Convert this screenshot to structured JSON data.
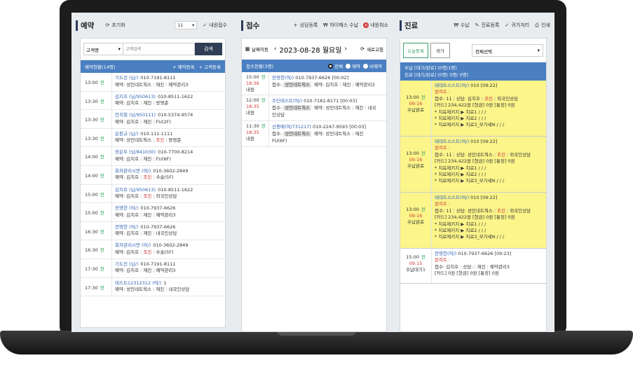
{
  "reservation": {
    "title": "예약",
    "reset": "초기화",
    "count_select": "11",
    "visit_checkbox": "내원접수",
    "search_type": "고객명",
    "search_placeholder": "고객검색",
    "search_button": "검색",
    "list_title": "예약현황(14명)",
    "add_reservation": "예약등록",
    "add_customer": "고객등록",
    "items": [
      {
        "time": "13:00",
        "status": "전",
        "name": "기도진 (님/)",
        "phone": "010-7191-8111",
        "line2_label": "예약:",
        "line2": [
          "성민네트웍스",
          "재진",
          "예약관리3"
        ],
        "red_index": -1
      },
      {
        "time": "13:30",
        "status": "전",
        "name": "김지호 (님/950613)",
        "phone": "010-8511-1622",
        "line2_label": "예약:",
        "line2": [
          "김치호",
          "재진",
          "왕영준"
        ],
        "red_index": -1
      },
      {
        "time": "13:30",
        "status": "전",
        "name": "안치철 (님/950111)",
        "phone": "010-5374-9574",
        "line2_label": "예약:",
        "line2": [
          "김치호",
          "재진",
          "FU(2F)"
        ],
        "red_index": -1
      },
      {
        "time": "13:30",
        "status": "전",
        "name": "은판규 (님/)",
        "phone": "010-111-1111",
        "line2_label": "예약:",
        "line2": [
          "성민네트웍스",
          "조진",
          "왕영준"
        ],
        "red_index": 1
      },
      {
        "time": "14:00",
        "status": "전",
        "name": "장은두 (님/841030)",
        "phone": "010-7700-8214",
        "line2_label": "예약:",
        "line2": [
          "김치호",
          "재진",
          "FU(6F)"
        ],
        "red_index": -1
      },
      {
        "time": "14:00",
        "status": "전",
        "name": "회차관리시면 (여/)",
        "phone": "010-3602-2849",
        "line2_label": "예약:",
        "line2": [
          "김치호",
          "조진",
          "수술(5F)"
        ],
        "red_index": 1
      },
      {
        "time": "15:00",
        "status": "전",
        "name": "김지호 (님/950613)",
        "phone": "010-8511-1622",
        "line2_label": "예약:",
        "line2": [
          "김치호",
          "조진",
          "외국인상담"
        ],
        "red_index": 1
      },
      {
        "time": "15:00",
        "status": "전",
        "name": "전영한 (여/)",
        "phone": "010-7937-6626",
        "line2_label": "예약:",
        "line2": [
          "김치호",
          "재진",
          "예약관리3"
        ],
        "red_index": -1
      },
      {
        "time": "16:30",
        "status": "전",
        "name": "전영한 (여/)",
        "phone": "010-7937-6626",
        "line2_label": "예약:",
        "line2": [
          "김치호",
          "재진",
          "내국인상담"
        ],
        "red_index": -1
      },
      {
        "time": "16:30",
        "status": "전",
        "name": "회차관리시면 (여/)",
        "phone": "010-3602-2849",
        "line2_label": "예약:",
        "line2": [
          "김치호",
          "조진",
          "수술(5F)"
        ],
        "red_index": 1
      },
      {
        "time": "17:30",
        "status": "전",
        "name": "기도진 (님/)",
        "phone": "010-7191-8111",
        "line2_label": "예약:",
        "line2": [
          "김치호",
          "재진",
          "예약관리3"
        ],
        "red_index": -1
      },
      {
        "time": "17:30",
        "status": "전",
        "name": "테스트12312312 (여/)",
        "phone": "1",
        "line2_label": "예약:",
        "line2": [
          "성민네트웍스",
          "재진",
          "내국인상담"
        ],
        "red_index": -1
      }
    ]
  },
  "reception": {
    "title": "접수",
    "btn_consult": "상담등록",
    "btn_payment": "하이패스 수납",
    "btn_cancel": "내원취소",
    "date_move": "날짜이동",
    "date": "2023-08-28 월요일",
    "refresh": "새로고침",
    "list_title": "접수현황(3명)",
    "filter_all": "전체",
    "filter_reservation": "예약",
    "filter_nonreservation": "비예약",
    "items": [
      {
        "time": "15:00",
        "status": "전",
        "time2": "18:36",
        "state": "내원",
        "name": "전영한(여/)",
        "phone": "010-7937-6626",
        "code": "[00:02]",
        "line2_label": "접수:",
        "tag": "성민네트웍스",
        "line2": [
          "예약: 김치호",
          "재진",
          "예약관리3"
        ],
        "line3": ""
      },
      {
        "time": "12:00",
        "status": "전",
        "time2": "18:35",
        "state": "내원",
        "name": "주딘테스트(여/)",
        "phone": "010-7181-8171",
        "code": "[00:03]",
        "line2_label": "접수:",
        "tag": "성민네트웍스",
        "line2": [
          "예약: 성민네트웍스",
          "재진",
          "내국"
        ],
        "line3": "인상담"
      },
      {
        "time": "11:30",
        "status": "전",
        "time2": "18:35",
        "state": "내원",
        "name": "산중배(여/731217)",
        "phone": "010-2247-9593",
        "code": "[00:03]",
        "line2_label": "접수:",
        "tag": "성민네트웍스",
        "line2": [
          "예약: 성민네트웍스",
          "재진"
        ],
        "line3": "FU(6F)"
      }
    ]
  },
  "treatment": {
    "title": "진료",
    "btn_payment": "수납",
    "btn_register": "진료등록",
    "btn_home": "귀가처리",
    "btn_print": "인쇄",
    "tab_today": "오늘등록",
    "tab_home": "귀가",
    "select_all": "전체선택",
    "summary1": "수납 [대기/완료] (0명/1명)",
    "summary2": "진료 [대기/완료] (0명/ 0명/ 0명)",
    "items": [
      {
        "time": "13:00",
        "status": "전",
        "time2": "09:16",
        "state": "수납완료",
        "highlight": true,
        "name": "테테트스스트(여/)",
        "code": "010 [09:22]",
        "label": "원차트 :",
        "info": "접수: 11",
        "consult": "상담: 김치호",
        "type": "조진",
        "dept": "외국인상담",
        "card": "[카드] 234,422원 [현금] 0원 [통장] 0원",
        "lines": [
          "* 치료제키지 ▶ 치료1 / / /",
          "* 치료제키지 ▶ 치료2 / / /",
          "* 치료제키지 ▶ 치료3_부가세N / / /"
        ]
      },
      {
        "time": "13:00",
        "status": "전",
        "time2": "09:16",
        "state": "수납완료",
        "highlight": true,
        "name": "테테트스스트(여/)",
        "code": "010 [09:22]",
        "label": "원차트 :",
        "info": "접수: 11",
        "consult": "상담: 성민네트웍스",
        "type": "조진",
        "dept": "외국인상담",
        "card": "[카드] 234,422원 [현금] 0원 [통장] 0원",
        "lines": [
          "* 치료제키지 ▶ 치료1 / / /",
          "* 치료제키지 ▶ 치료2 / / /",
          "* 치료제키지 ▶ 치료3_부가세N / / /"
        ]
      },
      {
        "time": "13:00",
        "status": "전",
        "time2": "09:16",
        "state": "수납완료",
        "highlight": true,
        "name": "테테트스스트(여/)",
        "code": "010 [09:22]",
        "label": "원차트 :",
        "info": "접수: 11",
        "consult": "상담: 성민네트웍스",
        "type": "조진",
        "dept": "외국인상담",
        "card": "[카드] 234,422원 [현금] 0원 [통장] 0원",
        "lines": [
          "* 치료제키지 ▶ 치료1 / / /",
          "* 치료제키지 ▶ 치료2 / / /",
          "* 치료제키지 ▶ 치료3_부가세N / / /"
        ]
      },
      {
        "time": "15:00",
        "status": "전",
        "time2": "09:15",
        "state": "수납대기1",
        "highlight": false,
        "name": "전영한(여/)",
        "code": "010-7937-6626 [09:23]",
        "label": "원차트 :",
        "info": "접수: 김치호",
        "consult": "상담:",
        "type": "재진",
        "dept": "예약관리3",
        "card": "[카드] 0원 [현금] 0원 [통장] 0원",
        "lines": []
      }
    ]
  }
}
